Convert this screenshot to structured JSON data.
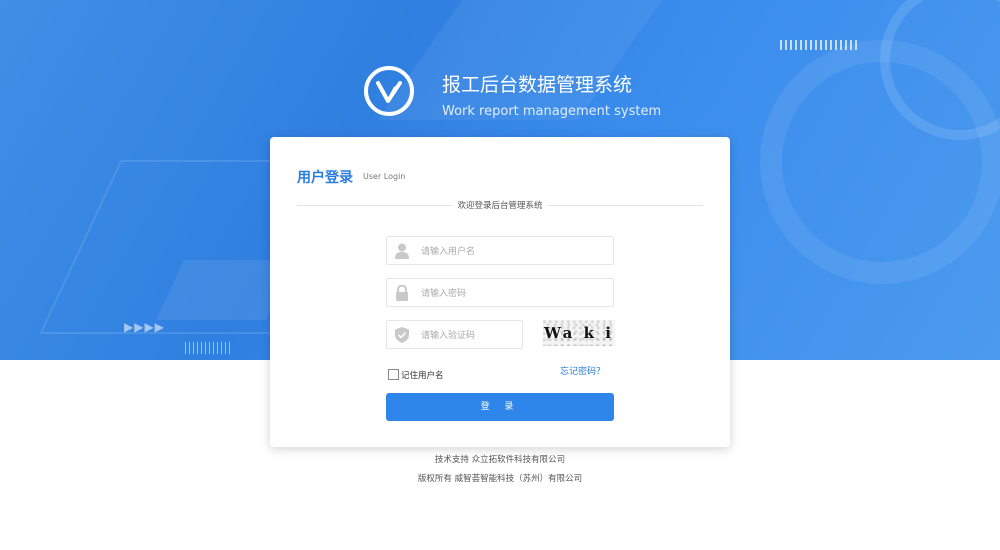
{
  "brand": {
    "title": "报工后台数据管理系统",
    "subtitle": "Work report management system",
    "logo_icon": "v-logo-icon"
  },
  "login": {
    "title": "用户登录",
    "subtitle": "User Login",
    "welcome": "欢迎登录后台管理系统",
    "username": {
      "placeholder": "请输入用户名",
      "value": "",
      "icon": "user-icon"
    },
    "password": {
      "placeholder": "请输入密码",
      "value": "",
      "icon": "lock-icon"
    },
    "captcha": {
      "placeholder": "请输入验证码",
      "value": "",
      "icon": "shield-icon",
      "image_text": "Wa k i"
    },
    "remember_label": "记住用户名",
    "remember_checked": false,
    "forgot_label": "忘记密码？",
    "submit_label": "登 录"
  },
  "footer": {
    "support": "技术支持 众立拓软件科技有限公司",
    "copyright": "版权所有 威智荟智能科技（苏州）有限公司"
  },
  "colors": {
    "primary": "#2f86ea",
    "hero_background": "#3b8ded",
    "title_blue": "#2a7ce0"
  }
}
